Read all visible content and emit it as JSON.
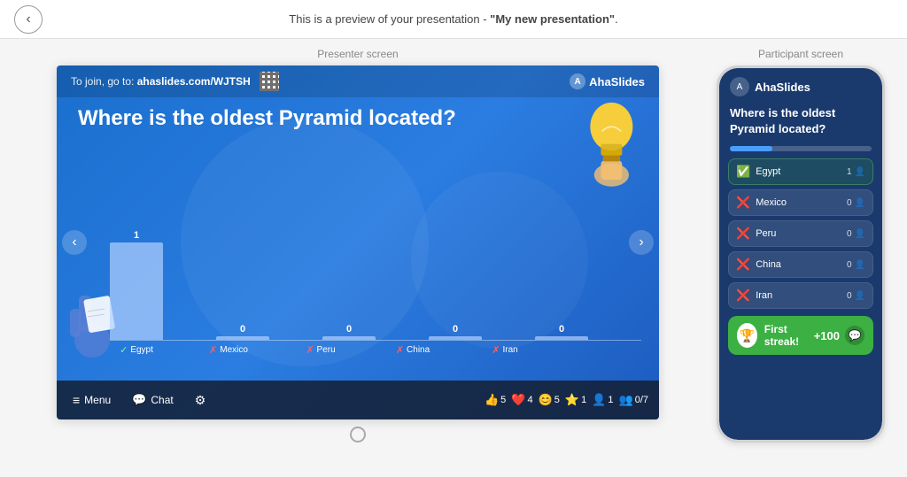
{
  "topbar": {
    "preview_text": "This is a preview of your presentation - ",
    "presentation_name": "\"My new presentation\"",
    "back_label": "←"
  },
  "presenter": {
    "section_label": "Presenter screen",
    "join_text": "To join, go to:",
    "join_url": "ahaslides.com/WJTSH",
    "logo": "AhaSlides",
    "question": "Where is the oldest Pyramid located?",
    "chart": {
      "bars": [
        {
          "label": "Egypt",
          "count": 1,
          "height": 110,
          "correct": true
        },
        {
          "label": "Mexico",
          "count": 0,
          "height": 4,
          "correct": false
        },
        {
          "label": "Peru",
          "count": 0,
          "height": 4,
          "correct": false
        },
        {
          "label": "China",
          "count": 0,
          "height": 4,
          "correct": false
        },
        {
          "label": "Iran",
          "count": 0,
          "height": 4,
          "correct": false
        }
      ]
    },
    "controls": {
      "menu_label": "Menu",
      "chat_label": "Chat",
      "reactions": [
        {
          "icon": "👍",
          "count": "5"
        },
        {
          "icon": "❤️",
          "count": "4"
        },
        {
          "icon": "😊",
          "count": "5"
        },
        {
          "icon": "⭐",
          "count": "1"
        },
        {
          "icon": "👤",
          "count": "1"
        },
        {
          "icon": "👥",
          "count": "0/7"
        }
      ]
    }
  },
  "participant": {
    "section_label": "Participant screen",
    "logo": "AhaSlides",
    "question": "Where is the oldest Pyramid located?",
    "progress_pct": 30,
    "answers": [
      {
        "text": "Egypt",
        "count": "1",
        "correct": true
      },
      {
        "text": "Mexico",
        "count": "0",
        "correct": false
      },
      {
        "text": "Peru",
        "count": "0",
        "correct": false
      },
      {
        "text": "China",
        "count": "0",
        "correct": false
      },
      {
        "text": "Iran",
        "count": "0",
        "correct": false
      }
    ],
    "streak": {
      "title": "First streak!",
      "points": "+100"
    }
  }
}
